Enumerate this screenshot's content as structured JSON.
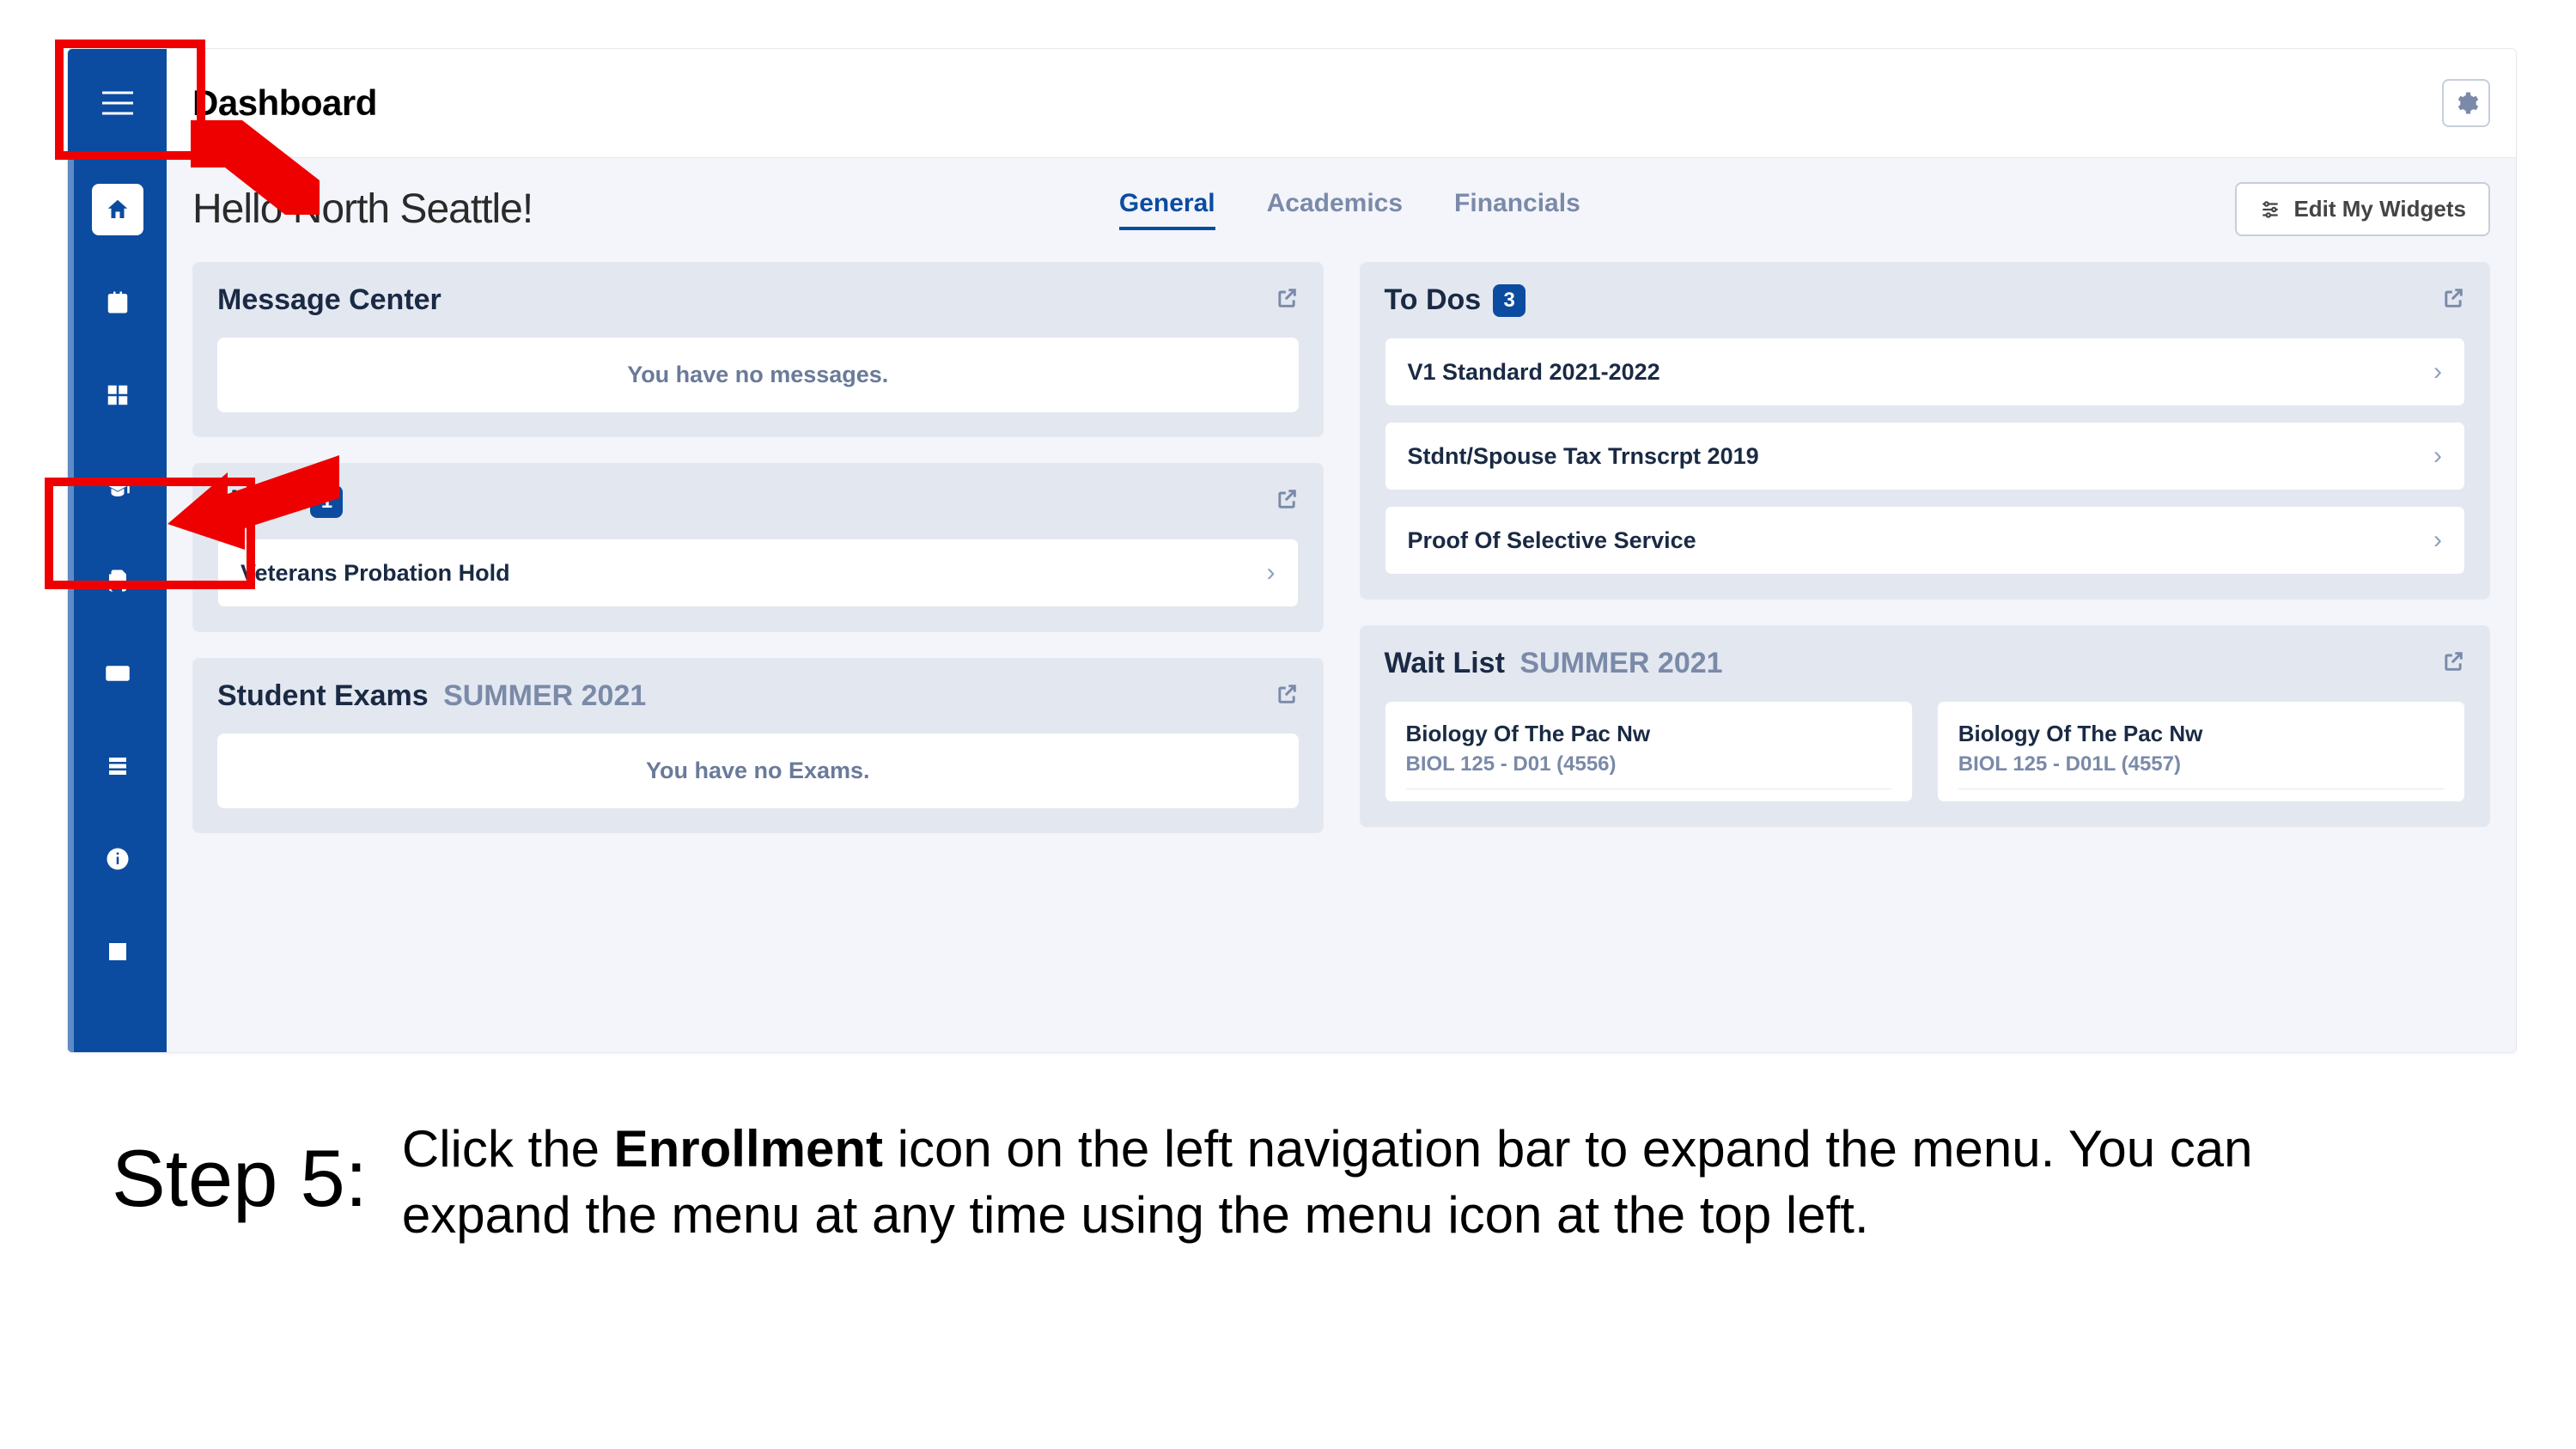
{
  "header": {
    "title": "Dashboard",
    "edit_widgets": "Edit My Widgets"
  },
  "hello": "Hello North Seattle!",
  "tabs": {
    "general": "General",
    "academics": "Academics",
    "financials": "Financials"
  },
  "sidebar": {
    "items": [
      {
        "name": "home",
        "active": true
      },
      {
        "name": "calendar"
      },
      {
        "name": "dashboard-tiles"
      },
      {
        "name": "enrollment"
      },
      {
        "name": "documents"
      },
      {
        "name": "payments"
      },
      {
        "name": "records"
      },
      {
        "name": "info"
      },
      {
        "name": "profile"
      }
    ]
  },
  "widgets": {
    "messages": {
      "title": "Message Center",
      "empty": "You have no messages."
    },
    "holds": {
      "title": "Holds",
      "count": "1",
      "items": [
        {
          "label": "Veterans Probation Hold"
        }
      ]
    },
    "exams": {
      "title": "Student Exams",
      "term": "SUMMER 2021",
      "empty": "You have no Exams."
    },
    "todos": {
      "title": "To Dos",
      "count": "3",
      "items": [
        {
          "label": "V1 Standard 2021-2022"
        },
        {
          "label": "Stdnt/Spouse Tax Trnscrpt 2019"
        },
        {
          "label": "Proof Of Selective Service"
        }
      ]
    },
    "waitlist": {
      "title": "Wait List",
      "term": "SUMMER 2021",
      "cards": [
        {
          "course": "Biology Of The Pac Nw",
          "code": "BIOL 125 - D01 (4556)"
        },
        {
          "course": "Biology Of The Pac Nw",
          "code": "BIOL 125 - D01L (4557)"
        }
      ]
    }
  },
  "instruction": {
    "step_label": "Step 5:",
    "text_pre": "Click the ",
    "text_bold": "Enrollment",
    "text_post": " icon on the left navigation bar to expand the menu. You can expand the menu at any time using the menu icon at the top left."
  }
}
